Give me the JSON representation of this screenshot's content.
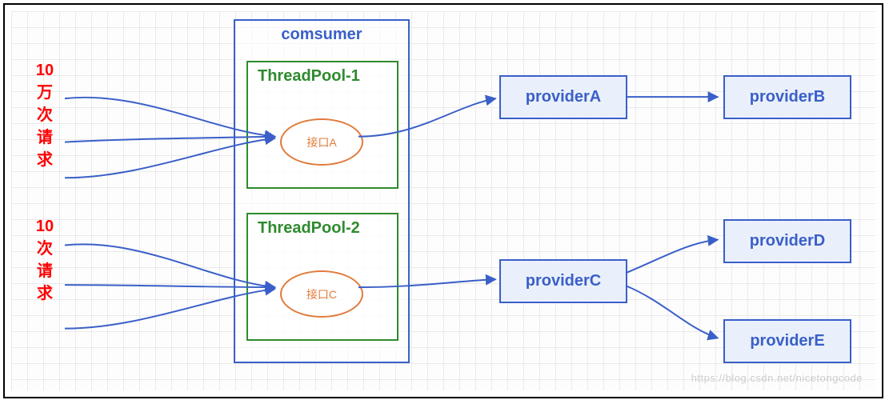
{
  "requests": {
    "top_label": "10\n万\n次\n请\n求",
    "bottom_label": "10\n次\n请\n求"
  },
  "consumer": {
    "title": "comsumer",
    "pools": [
      {
        "title": "ThreadPool-1",
        "interface": "接口A"
      },
      {
        "title": "ThreadPool-2",
        "interface": "接口C"
      }
    ]
  },
  "providers": {
    "a": "providerA",
    "b": "providerB",
    "c": "providerC",
    "d": "providerD",
    "e": "providerE"
  },
  "watermark": "https://blog.csdn.net/nicetongcode"
}
